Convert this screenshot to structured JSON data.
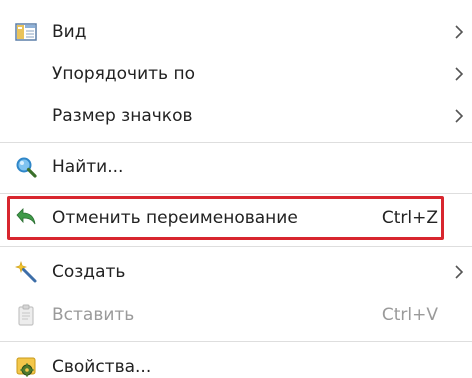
{
  "menu": {
    "items": [
      {
        "label": "Вид",
        "icon": "view-panel-icon",
        "has_submenu": true
      },
      {
        "label": "Упорядочить по",
        "icon": null,
        "has_submenu": true
      },
      {
        "label": "Размер значков",
        "icon": null,
        "has_submenu": true
      },
      {
        "label": "Найти...",
        "icon": "search-icon",
        "has_submenu": false
      },
      {
        "label": "Отменить переименование",
        "icon": "undo-arrow-icon",
        "shortcut": "Ctrl+Z",
        "highlighted": true
      },
      {
        "label": "Создать",
        "icon": "magic-wand-icon",
        "has_submenu": true
      },
      {
        "label": "Вставить",
        "icon": "clipboard-icon",
        "shortcut": "Ctrl+V",
        "disabled": true
      },
      {
        "label": "Свойства...",
        "icon": "properties-gear-icon",
        "has_submenu": false
      }
    ]
  },
  "colors": {
    "highlight_border": "#d8262e",
    "disabled_text": "#9a9a9a",
    "separator": "#dedede"
  }
}
